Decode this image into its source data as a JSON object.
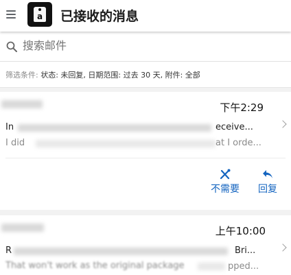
{
  "appbar": {
    "title": "已接收的消息",
    "logo_letter": "a",
    "menu_icon": "hamburger-icon",
    "logo_icon": "amazon-seller-tag-icon"
  },
  "search": {
    "placeholder": "搜索邮件",
    "icon": "search-icon"
  },
  "filter": {
    "label": "筛选条件:",
    "value": "状态: 未回复, 日期范围: 过去 30 天, 附件: 全部"
  },
  "messages": [
    {
      "time": "下午2:29",
      "subject_start": "In",
      "subject_end": "eceive...",
      "preview_start": "I did",
      "preview_end": "at I orde..."
    },
    {
      "time": "上午10:00",
      "subject_start": "R",
      "subject_end": "Bri...",
      "preview_start": "That won't work as the original package",
      "preview_end": "pped..."
    }
  ],
  "actions": {
    "not_needed": "不需要",
    "reply": "回复"
  },
  "colors": {
    "accent": "#1565c0",
    "text": "#212121",
    "muted": "#8a8a8a"
  }
}
